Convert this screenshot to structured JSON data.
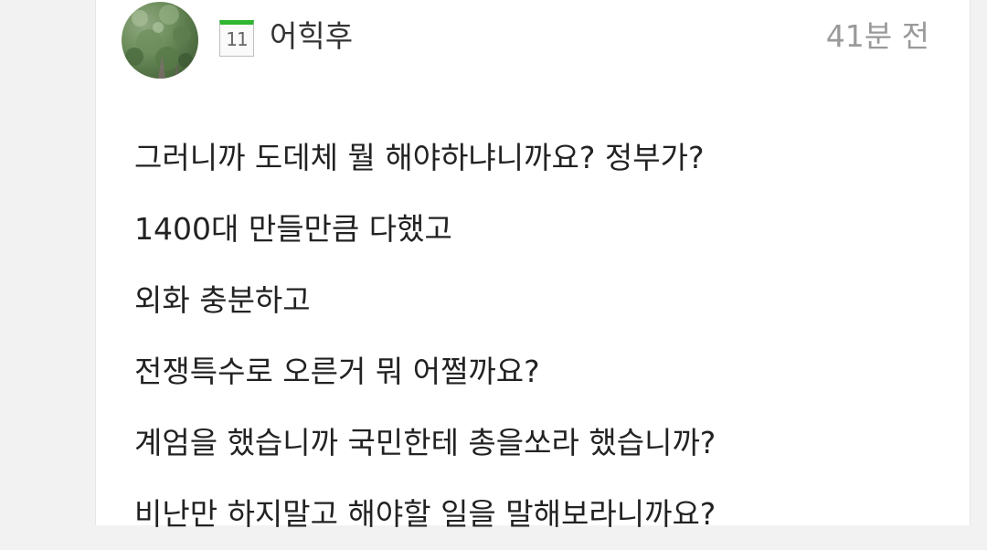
{
  "comment": {
    "author": {
      "level": "11",
      "name": "어힉후"
    },
    "time_ago": "41분 전",
    "lines": [
      "그러니까 도데체 뭘 해야하냐니까요? 정부가?",
      "1400대 만들만큼 다했고",
      "외화 충분하고",
      "전쟁특수로 오른거 뭐 어쩔까요?",
      "계엄을 했습니까 국민한테 총을쏘라 했습니까?",
      "비난만 하지말고 해야할 일을 말해보라니까요?"
    ]
  },
  "colors": {
    "level_badge_accent": "#2fb52f",
    "text": "#222222",
    "muted": "#9a9a9a"
  }
}
